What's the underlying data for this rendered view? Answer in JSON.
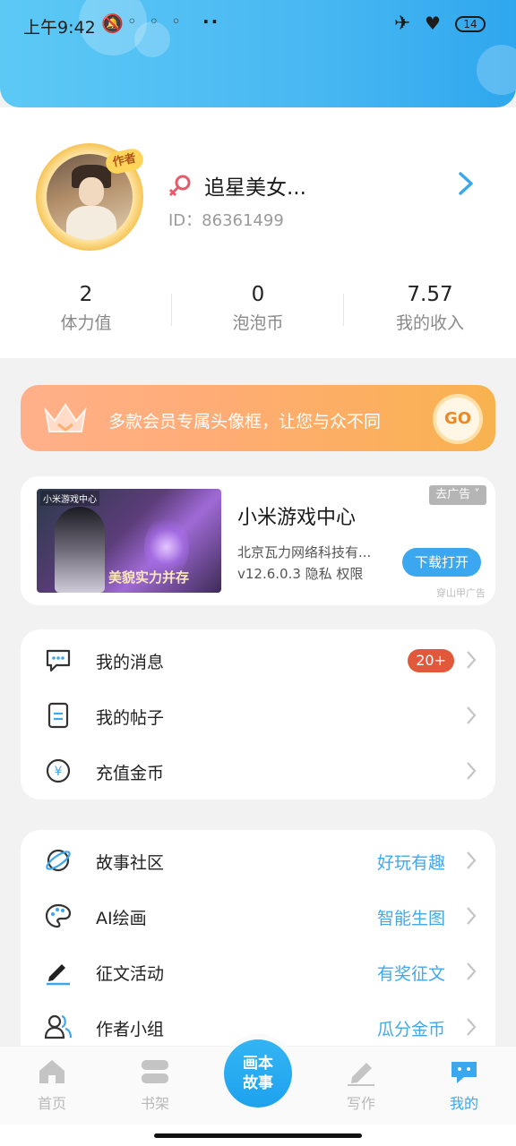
{
  "status_bar": {
    "time": "上午9:42",
    "battery": "14"
  },
  "profile": {
    "author_tag": "作者",
    "username": "追星美女...",
    "user_id": "ID：86361499",
    "stats": [
      {
        "value": "2",
        "label": "体力值"
      },
      {
        "value": "0",
        "label": "泡泡币"
      },
      {
        "value": "7.57",
        "label": "我的收入"
      }
    ]
  },
  "vip_banner": {
    "text": "多款会员专属头像框，让您与众不同",
    "go_label": "GO"
  },
  "ad": {
    "brand": "小米游戏中心",
    "slogan": "美貌实力并存",
    "title": "小米游戏中心",
    "publisher": "北京瓦力网络科技有...",
    "version_line": "v12.6.0.3  隐私  权限",
    "remove_label": "去广告 ˅",
    "download_label": "下载打开",
    "source": "穿山甲广告"
  },
  "menu_group_1": [
    {
      "label": "我的消息",
      "badge": "20+",
      "icon": "message-icon"
    },
    {
      "label": "我的帖子",
      "icon": "document-icon"
    },
    {
      "label": "充值金币",
      "icon": "coin-icon"
    }
  ],
  "menu_group_2": [
    {
      "label": "故事社区",
      "hint": "好玩有趣",
      "icon": "planet-icon"
    },
    {
      "label": "AI绘画",
      "hint": "智能生图",
      "icon": "palette-icon"
    },
    {
      "label": "征文活动",
      "hint": "有奖征文",
      "icon": "pen-icon"
    },
    {
      "label": "作者小组",
      "hint": "瓜分金币",
      "icon": "group-icon"
    }
  ],
  "tabbar": {
    "tabs": [
      {
        "label": "首页",
        "icon": "home-icon"
      },
      {
        "label": "书架",
        "icon": "bookshelf-icon"
      },
      {
        "label": "写作",
        "icon": "write-icon"
      },
      {
        "label": "我的",
        "icon": "me-icon"
      }
    ],
    "center_line1": "画本",
    "center_line2": "故事",
    "active_tab": "我的"
  },
  "colors": {
    "accent": "#3aa7ee",
    "hint": "#44a8e8",
    "badge": "#e1583a"
  }
}
